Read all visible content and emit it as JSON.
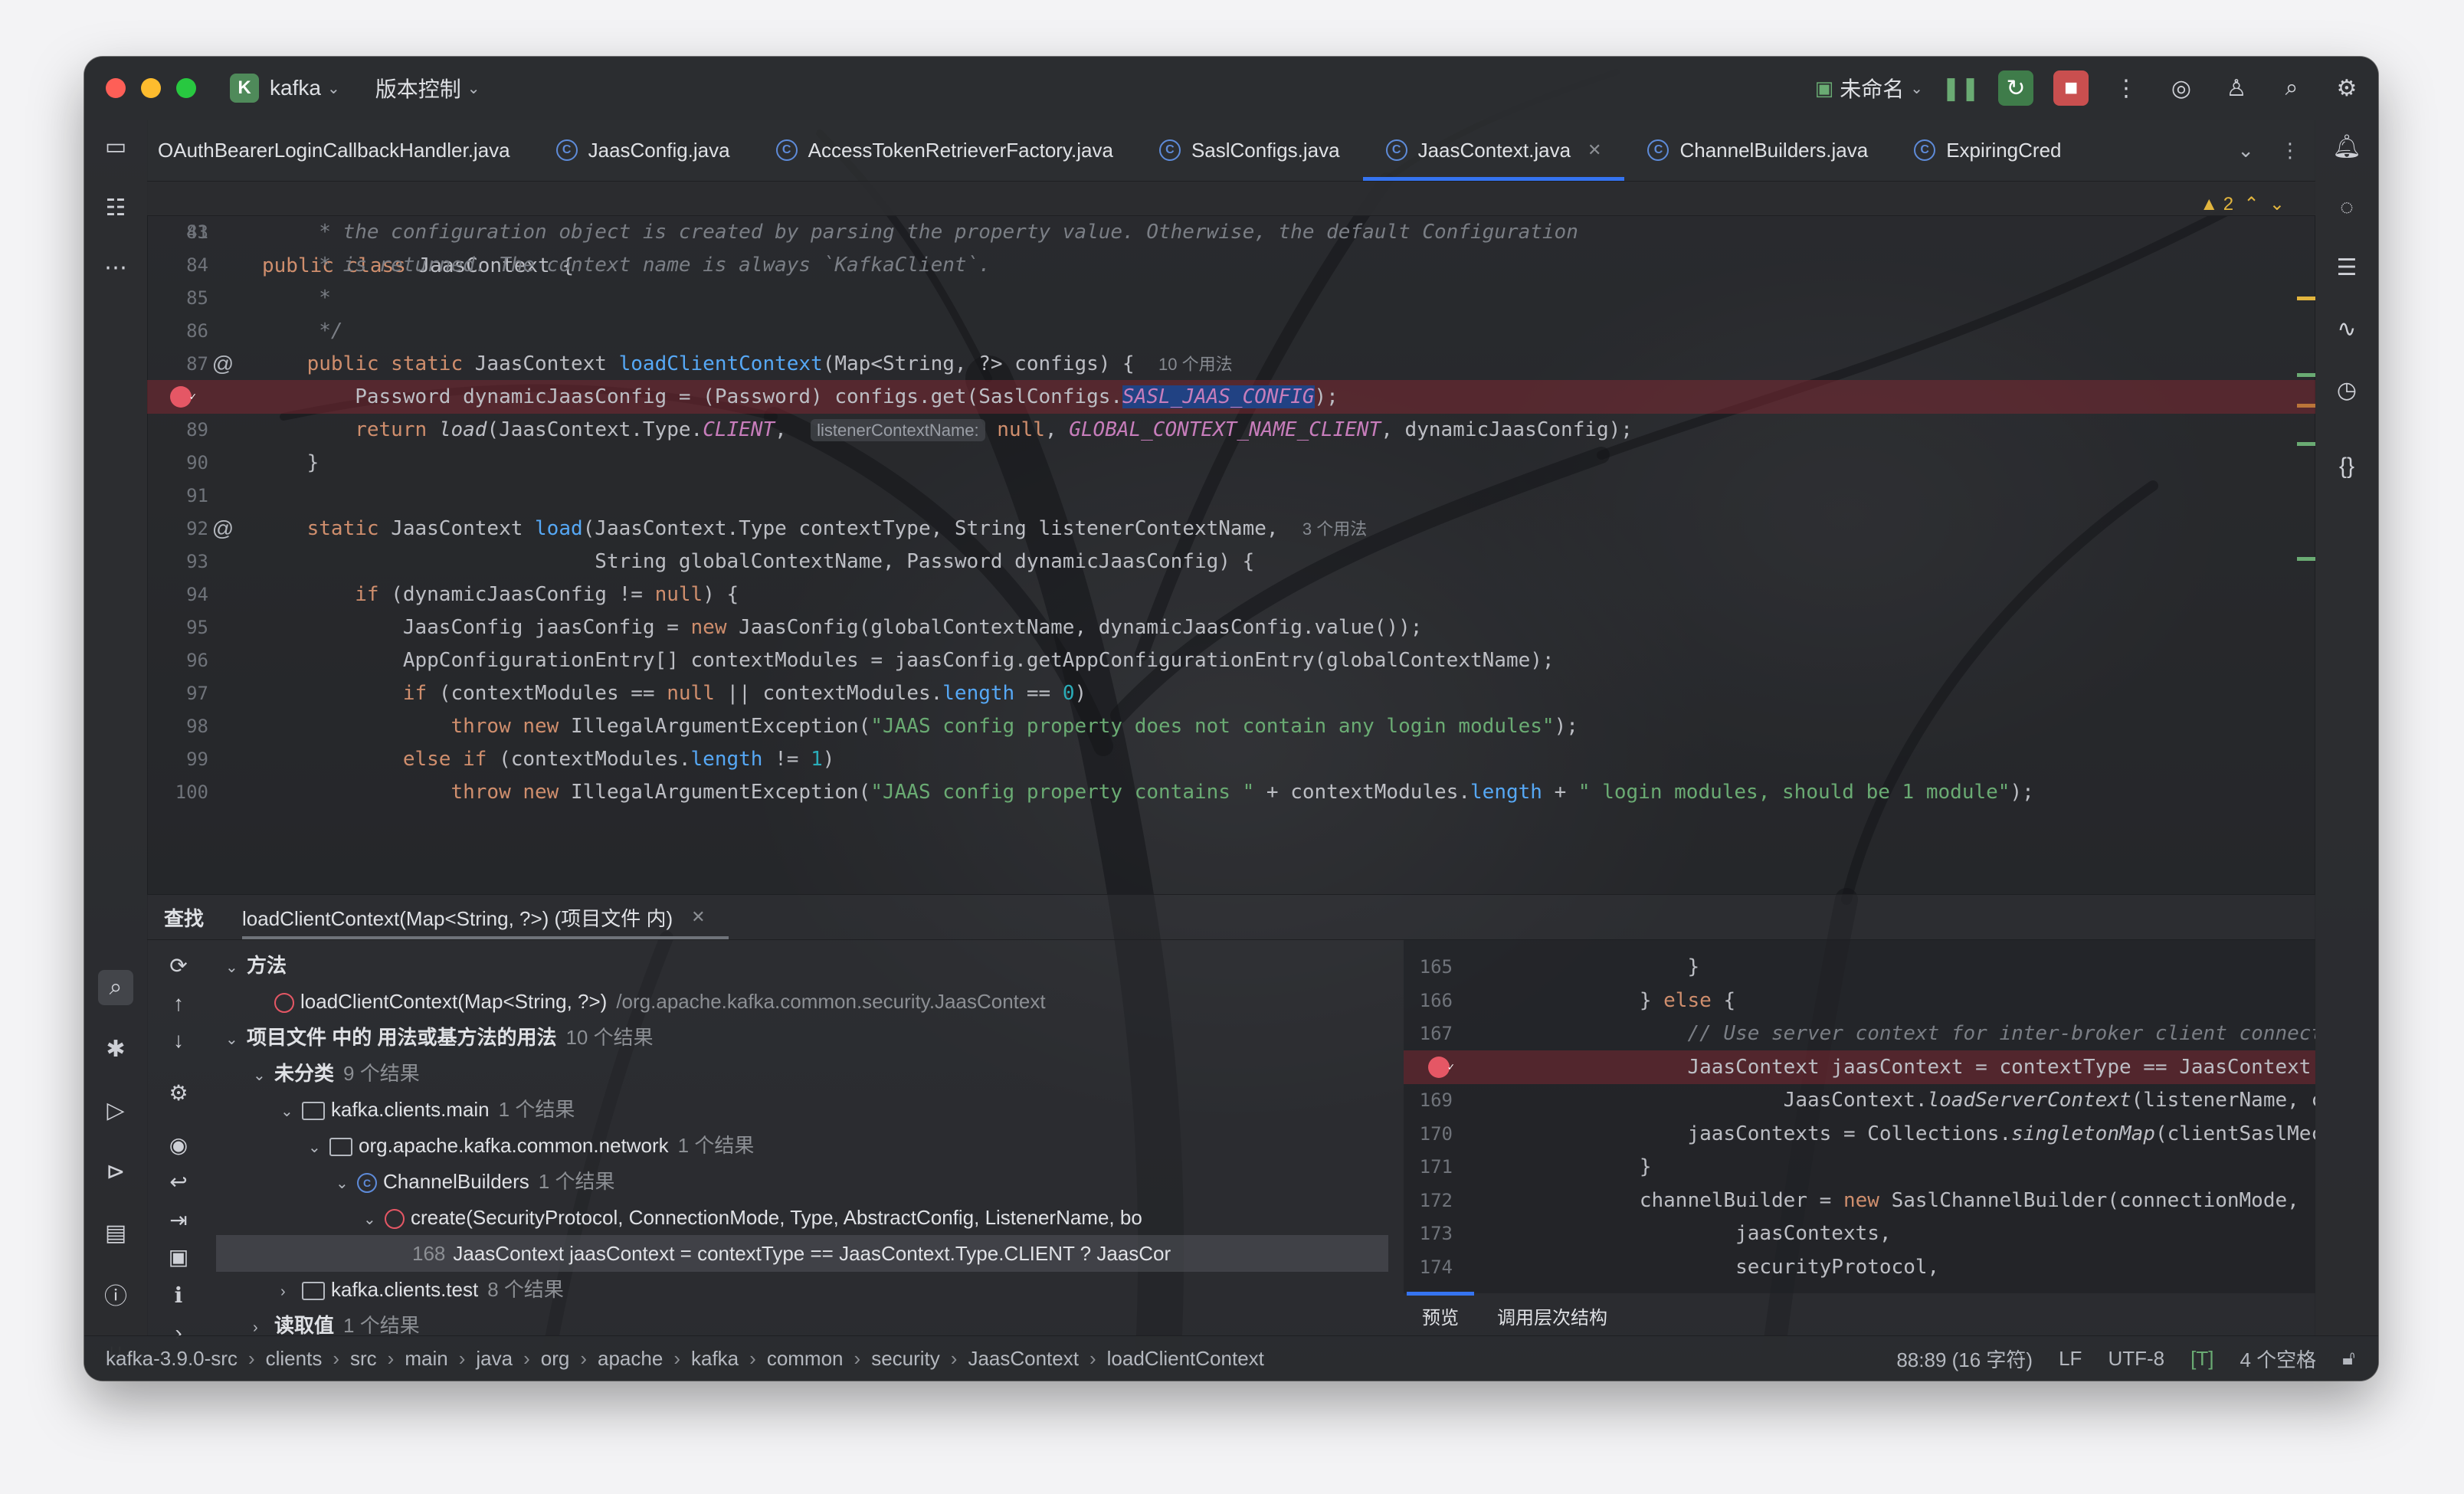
{
  "titlebar": {
    "project_badge": "K",
    "project_name": "kafka",
    "vcs_label": "版本控制",
    "run_config": "未命名",
    "icons": [
      "pause-icon",
      "rerun-icon",
      "stop-icon",
      "more-icon",
      "copilot-icon",
      "add-user-icon",
      "search-icon",
      "settings-icon"
    ]
  },
  "tabs": [
    {
      "label": "OAuthBearerLoginCallbackHandler.java",
      "active": false
    },
    {
      "label": "JaasConfig.java",
      "active": false
    },
    {
      "label": "AccessTokenRetrieverFactory.java",
      "active": false
    },
    {
      "label": "SaslConfigs.java",
      "active": false
    },
    {
      "label": "JaasContext.java",
      "active": true
    },
    {
      "label": "ChannelBuilders.java",
      "active": false
    },
    {
      "label": "ExpiringCred",
      "active": false
    }
  ],
  "editor": {
    "warning_count": "2",
    "sticky": {
      "line": "41",
      "text": "public class JaasContext {"
    },
    "lines": [
      {
        "n": "83",
        "parts": [
          [
            "cm",
            "     * the configuration object is created by parsing the property value. Otherwise, the default Configuration"
          ]
        ]
      },
      {
        "n": "84",
        "parts": [
          [
            "cm",
            "     * is returned. The context name is always `KafkaClient`."
          ]
        ]
      },
      {
        "n": "85",
        "parts": [
          [
            "cm",
            "     *"
          ]
        ]
      },
      {
        "n": "86",
        "parts": [
          [
            "cm",
            "     */"
          ]
        ]
      },
      {
        "n": "87",
        "parts": [
          [
            "kw",
            "    public static "
          ],
          [
            "",
            "JaasContext "
          ],
          [
            "fn",
            "loadClientContext"
          ],
          [
            "",
            "(Map<String, ?> configs) {  "
          ],
          [
            "hint",
            "10 个用法"
          ]
        ]
      },
      {
        "n": "",
        "bp": true,
        "parts": [
          [
            "",
            "        Password dynamicJaasConfig = (Password) configs.get(SaslConfigs."
          ],
          [
            "cs sel",
            "SASL_JAAS_CONFIG"
          ],
          [
            "",
            ");"
          ]
        ]
      },
      {
        "n": "89",
        "parts": [
          [
            "kw",
            "        return "
          ],
          [
            "it",
            "load"
          ],
          [
            "",
            "(JaasContext.Type."
          ],
          [
            "cs",
            "CLIENT"
          ],
          [
            "",
            ",  "
          ],
          [
            "hintbox",
            "listenerContextName:"
          ],
          [
            "kw",
            " null"
          ],
          [
            "",
            ", "
          ],
          [
            "cs",
            "GLOBAL_CONTEXT_NAME_CLIENT"
          ],
          [
            "",
            ", dynamicJaasConfig);"
          ]
        ]
      },
      {
        "n": "90",
        "parts": [
          [
            "",
            "    }"
          ]
        ]
      },
      {
        "n": "91",
        "parts": [
          [
            "",
            ""
          ]
        ]
      },
      {
        "n": "92",
        "parts": [
          [
            "kw",
            "    static "
          ],
          [
            "",
            "JaasContext "
          ],
          [
            "fn",
            "load"
          ],
          [
            "",
            "(JaasContext.Type contextType, String listenerContextName,  "
          ],
          [
            "hint",
            "3 个用法"
          ]
        ]
      },
      {
        "n": "93",
        "parts": [
          [
            "",
            "                            String globalContextName, Password dynamicJaasConfig) {"
          ]
        ]
      },
      {
        "n": "94",
        "parts": [
          [
            "kw",
            "        if "
          ],
          [
            "",
            "(dynamicJaasConfig != "
          ],
          [
            "kw",
            "null"
          ],
          [
            "",
            ") {"
          ]
        ]
      },
      {
        "n": "95",
        "parts": [
          [
            "",
            "            JaasConfig jaasConfig = "
          ],
          [
            "kw",
            "new "
          ],
          [
            "",
            "JaasConfig(globalContextName, dynamicJaasConfig.value());"
          ]
        ]
      },
      {
        "n": "96",
        "parts": [
          [
            "",
            "            AppConfigurationEntry[] contextModules = jaasConfig.getAppConfigurationEntry(globalContextName);"
          ]
        ]
      },
      {
        "n": "97",
        "parts": [
          [
            "kw",
            "            if "
          ],
          [
            "",
            "(contextModules == "
          ],
          [
            "kw",
            "null "
          ],
          [
            "",
            "|| contextModules."
          ],
          [
            "fn",
            "length"
          ],
          [
            "",
            " == "
          ],
          [
            "nm",
            "0"
          ],
          [
            "",
            ")"
          ]
        ]
      },
      {
        "n": "98",
        "parts": [
          [
            "kw",
            "                throw new "
          ],
          [
            "",
            "IllegalArgumentException("
          ],
          [
            "st",
            "\"JAAS config property does not contain any login modules\""
          ],
          [
            "",
            ");"
          ]
        ]
      },
      {
        "n": "99",
        "parts": [
          [
            "kw",
            "            else if "
          ],
          [
            "",
            "(contextModules."
          ],
          [
            "fn",
            "length"
          ],
          [
            "",
            " != "
          ],
          [
            "nm",
            "1"
          ],
          [
            "",
            ")"
          ]
        ]
      },
      {
        "n": "100",
        "parts": [
          [
            "kw",
            "                throw new "
          ],
          [
            "",
            "IllegalArgumentException("
          ],
          [
            "st",
            "\"JAAS config property contains \""
          ],
          [
            "",
            " + contextModules."
          ],
          [
            "fn",
            "length"
          ],
          [
            "",
            " + "
          ],
          [
            "st",
            "\" login modules, should be 1 module\""
          ],
          [
            "",
            ");"
          ]
        ]
      }
    ]
  },
  "find": {
    "title": "查找",
    "query_tab": "loadClientContext(Map<String, ?>) (项目文件 内)",
    "tree": [
      {
        "indent": 0,
        "arrow": "⌄",
        "icon": "",
        "text": "方法",
        "bold": true,
        "meta": ""
      },
      {
        "indent": 1,
        "arrow": "",
        "icon": "method",
        "text": "loadClientContext(Map<String, ?>)",
        "bold": false,
        "meta": "/org.apache.kafka.common.security.JaasContext"
      },
      {
        "indent": 0,
        "arrow": "⌄",
        "icon": "",
        "text": "项目文件 中的 用法或基方法的用法",
        "bold": true,
        "meta": "10 个结果"
      },
      {
        "indent": 1,
        "arrow": "⌄",
        "icon": "",
        "text": "未分类",
        "bold": true,
        "meta": "9 个结果"
      },
      {
        "indent": 2,
        "arrow": "⌄",
        "icon": "folder",
        "text": "kafka.clients.main",
        "bold": false,
        "meta": "1 个结果"
      },
      {
        "indent": 3,
        "arrow": "⌄",
        "icon": "folder",
        "text": "org.apache.kafka.common.network",
        "bold": false,
        "meta": "1 个结果"
      },
      {
        "indent": 4,
        "arrow": "⌄",
        "icon": "class",
        "text": "ChannelBuilders",
        "bold": false,
        "meta": "1 个结果"
      },
      {
        "indent": 5,
        "arrow": "⌄",
        "icon": "method",
        "text": "create(SecurityProtocol, ConnectionMode, Type, AbstractConfig, ListenerName, bo",
        "bold": false,
        "meta": ""
      },
      {
        "indent": 6,
        "arrow": "",
        "icon": "",
        "text": "JaasContext jaasContext = contextType == JaasContext.Type.CLIENT ? JaasCor",
        "bold": false,
        "meta": "",
        "lineno": "168",
        "selected": true
      },
      {
        "indent": 2,
        "arrow": "›",
        "icon": "folder",
        "text": "kafka.clients.test",
        "bold": false,
        "meta": "8 个结果"
      },
      {
        "indent": 1,
        "arrow": "›",
        "icon": "",
        "text": "读取值",
        "bold": true,
        "meta": "1 个结果"
      }
    ],
    "preview_lines": [
      {
        "n": "165",
        "parts": [
          [
            "",
            "                }"
          ]
        ]
      },
      {
        "n": "166",
        "parts": [
          [
            "",
            "            } "
          ],
          [
            "kw",
            "else "
          ],
          [
            "",
            "{"
          ]
        ]
      },
      {
        "n": "167",
        "parts": [
          [
            "cm",
            "                // Use server context for inter-broker client connections a"
          ]
        ]
      },
      {
        "n": "",
        "bp": true,
        "parts": [
          [
            "",
            "                JaasContext jaasContext = contextType == JaasContext.Type."
          ],
          [
            "cs",
            "C"
          ]
        ]
      },
      {
        "n": "169",
        "parts": [
          [
            "",
            "                        JaasContext."
          ],
          [
            "it",
            "loadServerContext"
          ],
          [
            "",
            "(listenerName, clientS"
          ]
        ]
      },
      {
        "n": "170",
        "parts": [
          [
            "",
            "                jaasContexts = Collections."
          ],
          [
            "it",
            "singletonMap"
          ],
          [
            "",
            "(clientSaslMechanism"
          ]
        ]
      },
      {
        "n": "171",
        "parts": [
          [
            "",
            "            }"
          ]
        ]
      },
      {
        "n": "172",
        "parts": [
          [
            "",
            "            channelBuilder = "
          ],
          [
            "kw",
            "new "
          ],
          [
            "",
            "SaslChannelBuilder(connectionMode,"
          ]
        ]
      },
      {
        "n": "173",
        "parts": [
          [
            "",
            "                    jaasContexts,"
          ]
        ]
      },
      {
        "n": "174",
        "parts": [
          [
            "",
            "                    securityProtocol,"
          ]
        ]
      }
    ],
    "preview_tab": "预览",
    "hierarchy_tab": "调用层次结构"
  },
  "statusbar": {
    "crumbs": [
      "kafka-3.9.0-src",
      "clients",
      "src",
      "main",
      "java",
      "org",
      "apache",
      "kafka",
      "common",
      "security",
      "JaasContext",
      "loadClientContext"
    ],
    "position": "88:89 (16 字符)",
    "line_sep": "LF",
    "encoding": "UTF-8",
    "indent_flag": "[T]",
    "indent": "4 个空格"
  },
  "colors": {
    "accent": "#3574f0",
    "breakpoint": "#e55765",
    "keyword": "#cf8e6d",
    "string": "#6aab73",
    "function": "#56a8f5"
  }
}
